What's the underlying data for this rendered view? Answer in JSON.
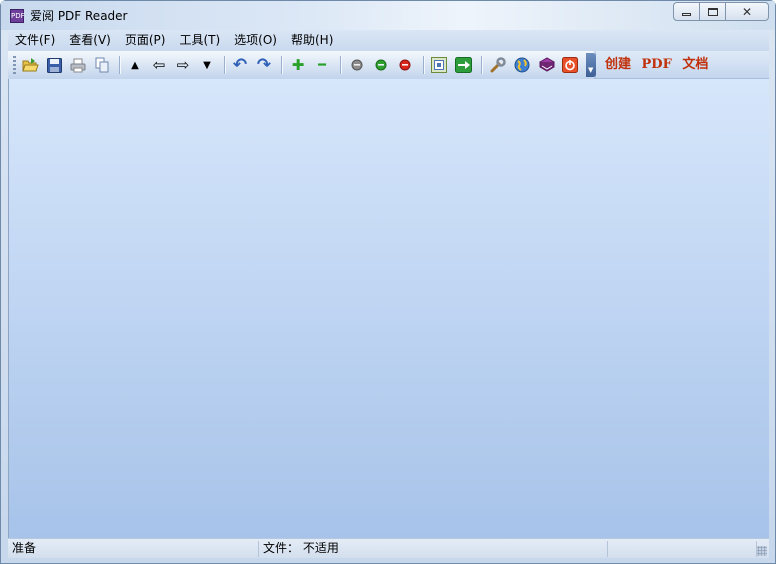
{
  "window": {
    "app_icon_text": "PDF",
    "title": "爱阅 PDF Reader",
    "controls": {
      "minimize": "minimize",
      "maximize": "maximize",
      "close": "✕"
    }
  },
  "menu": [
    {
      "label": "文件(F)"
    },
    {
      "label": "查看(V)"
    },
    {
      "label": "页面(P)"
    },
    {
      "label": "工具(T)"
    },
    {
      "label": "选项(O)"
    },
    {
      "label": "帮助(H)"
    }
  ],
  "toolbar": {
    "buttons": [
      {
        "icon": "open-folder-icon"
      },
      {
        "icon": "save-icon"
      },
      {
        "icon": "print-icon"
      },
      {
        "icon": "copy-icon"
      },
      {
        "icon": "first-page-icon",
        "glyph": "▲"
      },
      {
        "icon": "previous-page-icon",
        "glyph": "⇦"
      },
      {
        "icon": "next-page-icon",
        "glyph": "⇨"
      },
      {
        "icon": "last-page-icon",
        "glyph": "▼"
      },
      {
        "icon": "undo-icon",
        "glyph": "↶"
      },
      {
        "icon": "redo-icon",
        "glyph": "↷"
      },
      {
        "icon": "zoom-in-icon",
        "glyph": "✚"
      },
      {
        "icon": "zoom-out-icon",
        "glyph": "━"
      },
      {
        "icon": "gray-circle-icon"
      },
      {
        "icon": "green-circle-icon"
      },
      {
        "icon": "red-circle-icon"
      },
      {
        "icon": "fit-page-icon"
      },
      {
        "icon": "go-to-icon",
        "glyph": "➔"
      },
      {
        "icon": "settings-wrench-icon"
      },
      {
        "icon": "globe-icon"
      },
      {
        "icon": "book-icon"
      },
      {
        "icon": "power-icon",
        "glyph": "⏻"
      }
    ],
    "create_pdf_label": "创建 PDF 文档"
  },
  "statusbar": {
    "status": "准备",
    "file_label": "文件： 不适用"
  },
  "colors": {
    "accent_text": "#c0300a",
    "content_top": "#d6e6fb",
    "content_bottom": "#a7c3e9"
  }
}
